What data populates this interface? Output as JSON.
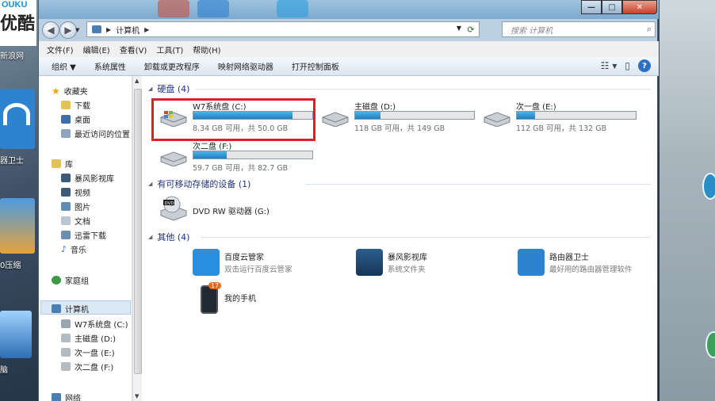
{
  "desktop": {
    "youku_label_top": "OUKU",
    "youku_label_big": "优酷",
    "icon_labels": [
      "新浪网",
      "器卫士",
      "0压缩",
      "脑"
    ]
  },
  "window": {
    "controls": {
      "minimize": "—",
      "maximize": "□",
      "close": "✕"
    }
  },
  "address": {
    "crumb": "计算机",
    "search_placeholder": "搜索 计算机"
  },
  "menubar": [
    "文件(F)",
    "编辑(E)",
    "查看(V)",
    "工具(T)",
    "帮助(H)"
  ],
  "toolbar": {
    "organize": "组织 ▼",
    "items": [
      "系统属性",
      "卸载或更改程序",
      "映射网络驱动器",
      "打开控制面板"
    ]
  },
  "sidebar": {
    "favorites": "收藏夹",
    "fav_items": [
      "下载",
      "桌面",
      "最近访问的位置"
    ],
    "libraries": "库",
    "lib_items": [
      "暴风影视库",
      "视频",
      "图片",
      "文档",
      "迅雷下载",
      "音乐"
    ],
    "homegroup": "家庭组",
    "computer": "计算机",
    "computer_items": [
      "W7系统盘 (C:)",
      "主磁盘 (D:)",
      "次一盘 (E:)",
      "次二盘 (F:)"
    ],
    "network": "网络"
  },
  "groups": {
    "hdd": "硬盘 (4)",
    "removable": "有可移动存储的设备 (1)",
    "other": "其他 (4)"
  },
  "drives": [
    {
      "name": "W7系统盘 (C:)",
      "free": "8.34 GB 可用，共 50.0 GB",
      "used_fraction": 0.83
    },
    {
      "name": "主磁盘 (D:)",
      "free": "118 GB 可用，共 149 GB",
      "used_fraction": 0.21
    },
    {
      "name": "次一盘 (E:)",
      "free": "112 GB 可用，共 132 GB",
      "used_fraction": 0.15
    },
    {
      "name": "次二盘 (F:)",
      "free": "59.7 GB 可用，共 82.7 GB",
      "used_fraction": 0.28
    }
  ],
  "removable": {
    "name": "DVD RW 驱动器 (G:)",
    "icon_text": "DVD"
  },
  "others": [
    {
      "name": "百度云管家",
      "desc": "双击运行百度云管家"
    },
    {
      "name": "暴风影视库",
      "desc": "系统文件夹"
    },
    {
      "name": "路由器卫士",
      "desc": "最好用的路由器管理软件"
    },
    {
      "name": "我的手机",
      "desc": "",
      "badge": "17"
    }
  ]
}
